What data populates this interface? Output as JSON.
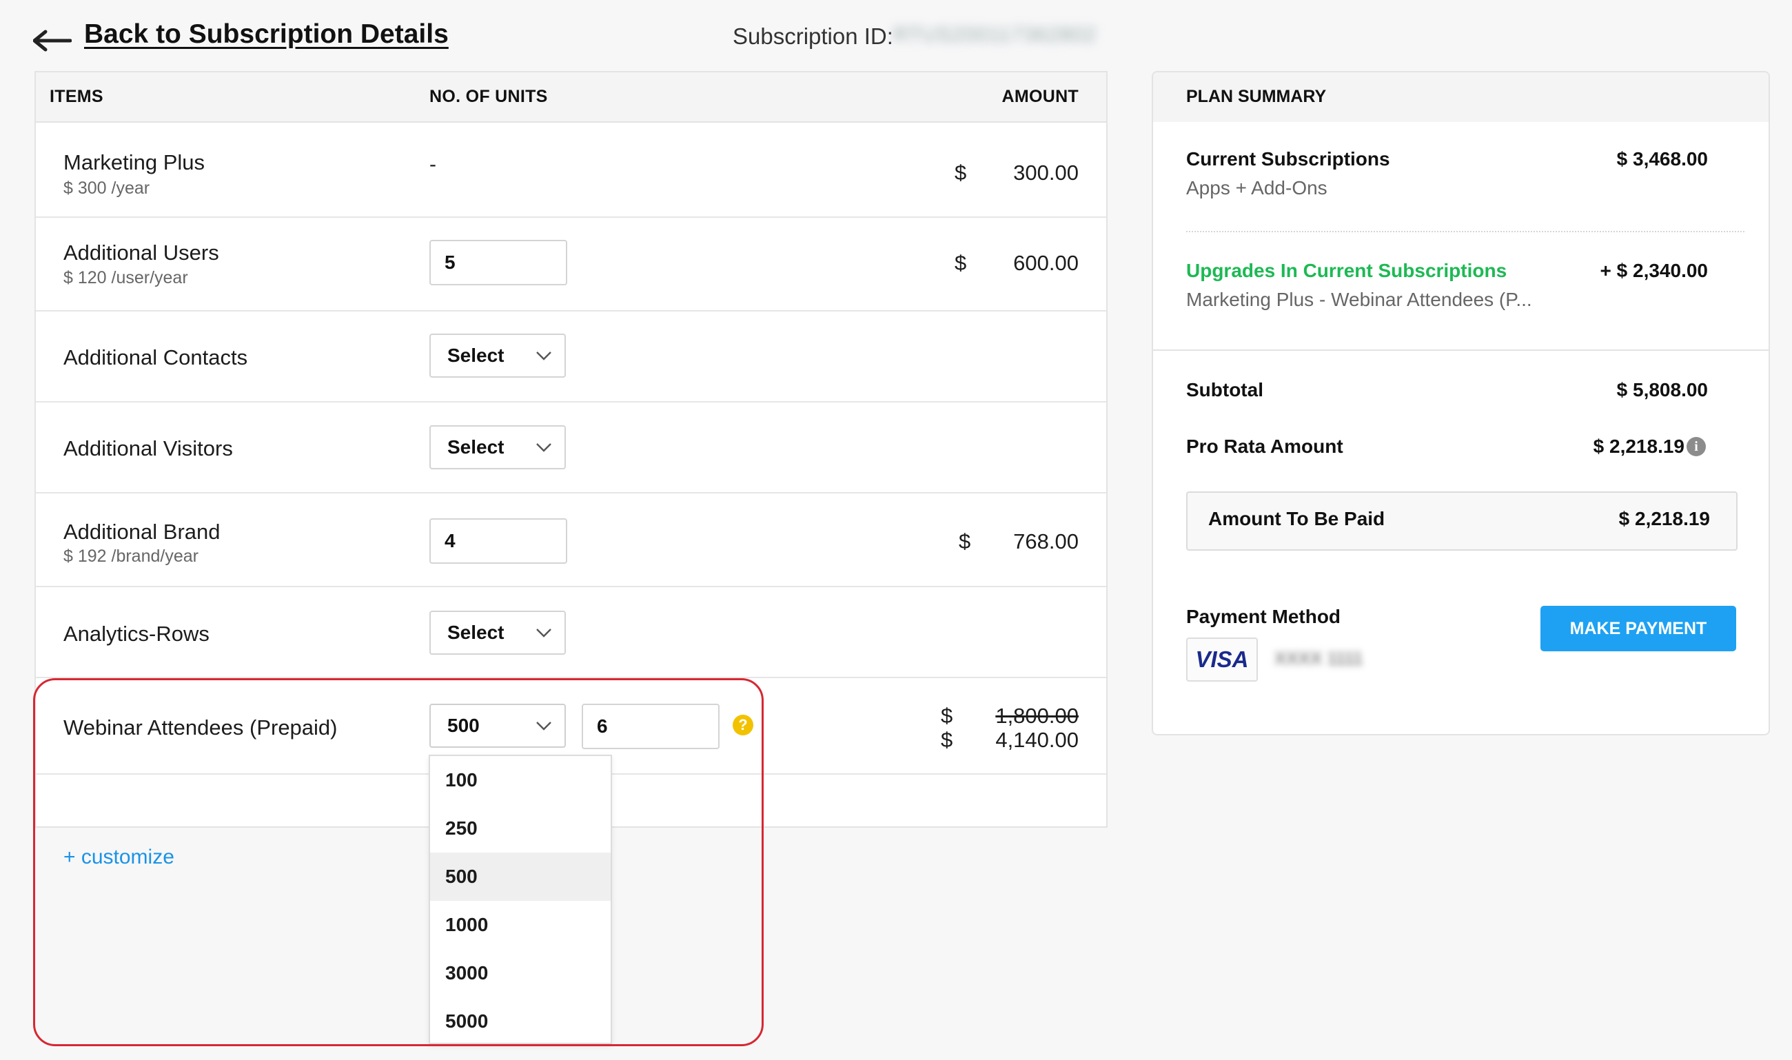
{
  "header": {
    "back_label": "Back to Subscription Details",
    "subscription_id_label": "Subscription ID:",
    "subscription_id_value": "RTUS200117362802"
  },
  "table": {
    "columns": [
      "ITEMS",
      "NO. OF UNITS",
      "AMOUNT"
    ],
    "rows": [
      {
        "name": "Marketing Plus",
        "price": "$ 300 /year",
        "units": "-",
        "currency": "$",
        "amount": "300.00"
      },
      {
        "name": "Additional Users",
        "price": "$ 120 /user/year",
        "units": "5",
        "currency": "$",
        "amount": "600.00"
      },
      {
        "name": "Additional Contacts",
        "select": "Select"
      },
      {
        "name": "Additional Visitors",
        "select": "Select"
      },
      {
        "name": "Additional Brand",
        "price": "$ 192 /brand/year",
        "units": "4",
        "currency": "$",
        "amount": "768.00"
      },
      {
        "name": "Analytics-Rows",
        "select": "Select"
      },
      {
        "name": "Webinar Attendees (Prepaid)",
        "select": "500",
        "units": "6",
        "currency": "$",
        "old_amount": "1,800.00",
        "amount": "4,140.00"
      }
    ],
    "customize_label": "+ customize"
  },
  "dropdown": {
    "options": [
      "100",
      "250",
      "500",
      "1000",
      "3000",
      "5000"
    ],
    "selected": "500"
  },
  "summary": {
    "title": "PLAN SUMMARY",
    "current_label": "Current Subscriptions",
    "current_sub": "Apps + Add-Ons",
    "current_value": "$ 3,468.00",
    "upgrade_label": "Upgrades In Current Subscriptions",
    "upgrade_sub": "Marketing Plus - Webinar Attendees (P...",
    "upgrade_value": "+ $ 2,340.00",
    "subtotal_label": "Subtotal",
    "subtotal_value": "$ 5,808.00",
    "prorata_label": "Pro Rata Amount",
    "prorata_value": "$ 2,218.19",
    "pay_label": "Amount To Be Paid",
    "pay_value": "$ 2,218.19",
    "method_label": "Payment Method",
    "make_payment": "MAKE PAYMENT",
    "card_brand": "VISA",
    "card_number": "XXXX 1111"
  },
  "colors": {
    "accent_blue": "#1ea1f2",
    "link_blue": "#1a93e6",
    "upgrade_green": "#1db954",
    "highlight_red": "#d62833",
    "help_yellow": "#f2c200"
  }
}
